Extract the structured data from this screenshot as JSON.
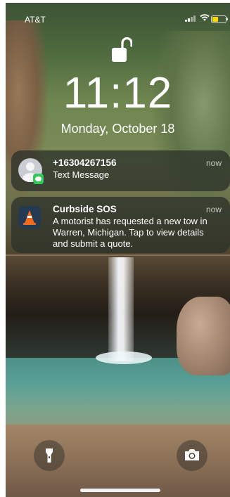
{
  "status_bar": {
    "carrier": "AT&T",
    "battery_level": 0.45,
    "battery_color": "#ffd60a"
  },
  "lock_screen": {
    "lock_icon": "unlocked-padlock-icon",
    "time": "11:12",
    "date": "Monday, October 18"
  },
  "notifications": [
    {
      "icon": "contact-avatar-icon",
      "badge_icon": "messages-app-icon",
      "title": "+16304267156",
      "body": "Text Message",
      "time": "now"
    },
    {
      "icon": "traffic-cone-app-icon",
      "title": "Curbside SOS",
      "body": "A motorist has requested a new tow in Warren, Michigan. Tap to view details and submit a quote.",
      "time": "now"
    }
  ],
  "controls": {
    "left_icon": "flashlight-icon",
    "right_icon": "camera-icon"
  },
  "colors": {
    "accent_badge": "#35c759",
    "cone_orange": "#f26b1d"
  }
}
